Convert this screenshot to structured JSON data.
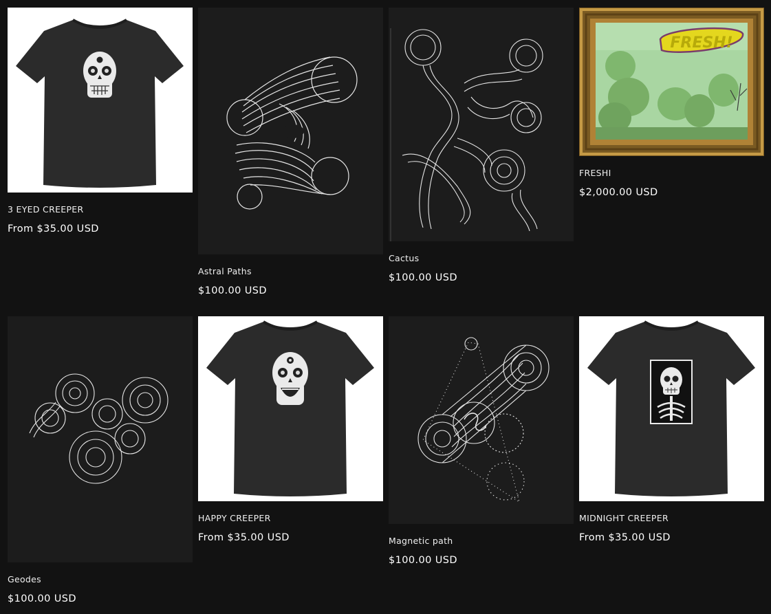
{
  "products": [
    {
      "title": "3 EYED CREEPER",
      "price": "From $35.00 USD",
      "image": "skull-tshirt-three-eyes"
    },
    {
      "title": "Astral Paths",
      "price": "$100.00 USD",
      "image": "line-art-print"
    },
    {
      "title": "Cactus",
      "price": "$100.00 USD",
      "image": "line-art-print"
    },
    {
      "title": "FRESHI",
      "price": "$2,000.00 USD",
      "image": "framed-graffiti-painting"
    },
    {
      "title": "Geodes",
      "price": "$100.00 USD",
      "image": "line-art-print"
    },
    {
      "title": "HAPPY CREEPER",
      "price": "From $35.00 USD",
      "image": "skull-tshirt-happy"
    },
    {
      "title": "Magnetic path",
      "price": "$100.00 USD",
      "image": "line-art-print"
    },
    {
      "title": "MIDNIGHT CREEPER",
      "price": "From $35.00 USD",
      "image": "skull-tshirt-skeleton"
    }
  ],
  "freshi_painting_text": "FRESH!",
  "colors": {
    "background": "#121212",
    "text": "#ffffff",
    "tshirt_backdrop": "#ffffff",
    "tshirt": "#2b2b2b",
    "print_backdrop": "#1c1c1c",
    "frame_gold": "#a57a2c",
    "painting_green": "#a9d6a2",
    "graffiti_yellow": "#e4d71e"
  }
}
